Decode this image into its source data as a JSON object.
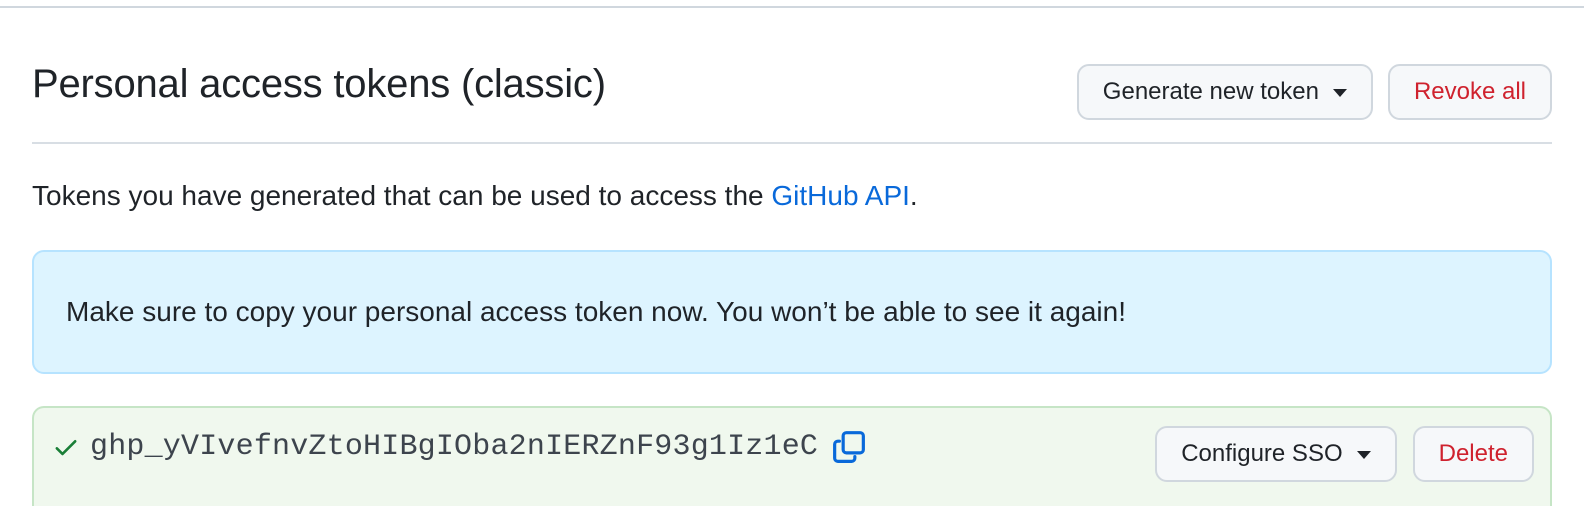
{
  "header": {
    "title": "Personal access tokens (classic)",
    "generate_label": "Generate new token",
    "revoke_label": "Revoke all"
  },
  "intro": {
    "prefix": "Tokens you have generated that can be used to access the ",
    "link": "GitHub API",
    "suffix": "."
  },
  "flash": {
    "message": "Make sure to copy your personal access token now. You won’t be able to see it again!"
  },
  "token": {
    "value": "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",
    "status_icon": "check-icon",
    "copy_icon": "copy-icon",
    "configure_label": "Configure SSO",
    "delete_label": "Delete"
  },
  "colors": {
    "link": "#0969da",
    "danger": "#cf222e",
    "success": "#1a7f37",
    "flash_bg": "#ddf4ff",
    "token_bg": "#f0f8ee"
  }
}
